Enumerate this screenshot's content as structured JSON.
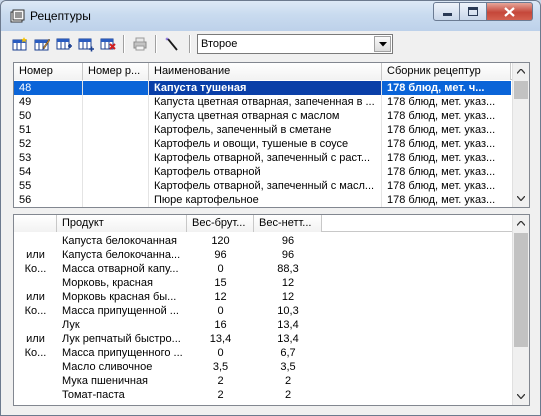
{
  "window": {
    "title": "Рецептуры"
  },
  "toolbar": {
    "buttons": [
      {
        "name": "new-recipe-button",
        "icon": "new-table-icon"
      },
      {
        "name": "edit-recipe-button",
        "icon": "edit-table-icon"
      },
      {
        "name": "add-row-button",
        "icon": "add-row-icon"
      },
      {
        "name": "insert-row-button",
        "icon": "insert-row-icon"
      },
      {
        "name": "delete-row-button",
        "icon": "delete-row-icon"
      },
      {
        "name": "print-button",
        "icon": "print-icon"
      },
      {
        "name": "wand-button",
        "icon": "wand-icon"
      }
    ],
    "combo_value": "Второе"
  },
  "recipes": {
    "columns": [
      "Номер",
      "Номер р...",
      "Наименование",
      "Сборник рецептур"
    ],
    "rows": [
      [
        "48",
        "",
        "Капуста тушеная",
        "178 блюд, мет. ч..."
      ],
      [
        "49",
        "",
        "Капуста цветная отварная, запеченная в ...",
        "178 блюд, мет. указ..."
      ],
      [
        "50",
        "",
        "Капуста цветная отварная с маслом",
        "178 блюд, мет. указ..."
      ],
      [
        "51",
        "",
        "Картофель, запеченный в сметане",
        "178 блюд, мет. указ..."
      ],
      [
        "52",
        "",
        "Картофель и овощи, тушеные в соусе",
        "178 блюд, мет. указ..."
      ],
      [
        "53",
        "",
        "Картофель отварной, запеченный с раст...",
        "178 блюд, мет. указ..."
      ],
      [
        "54",
        "",
        "Картофель отварной",
        "178 блюд, мет. указ..."
      ],
      [
        "55",
        "",
        "Картофель отварной, запеченный с масл...",
        "178 блюд, мет. указ..."
      ],
      [
        "56",
        "",
        "Пюре картофельное",
        "178 блюд, мет. указ..."
      ]
    ]
  },
  "ingredients": {
    "columns": [
      "",
      "Продукт",
      "Вес-брут...",
      "Вес-нетт..."
    ],
    "rows": [
      [
        "",
        "Капуста белокочанная",
        "120",
        "96"
      ],
      [
        "или",
        "Капуста белокочанна...",
        "96",
        "96"
      ],
      [
        "Ко...",
        "Масса отварной капу...",
        "0",
        "88,3"
      ],
      [
        "",
        "Морковь, красная",
        "15",
        "12"
      ],
      [
        "или",
        "Морковь красная бы...",
        "12",
        "12"
      ],
      [
        "Ко...",
        "Масса припущенной ...",
        "0",
        "10,3"
      ],
      [
        "",
        "Лук",
        "16",
        "13,4"
      ],
      [
        "или",
        "Лук репчатый быстро...",
        "13,4",
        "13,4"
      ],
      [
        "Ко...",
        "Масса припущенного ...",
        "0",
        "6,7"
      ],
      [
        "",
        "Масло сливочное",
        "3,5",
        "3,5"
      ],
      [
        "",
        "Мука пшеничная",
        "2",
        "2"
      ],
      [
        "",
        "Томат-паста",
        "2",
        "2"
      ]
    ]
  }
}
